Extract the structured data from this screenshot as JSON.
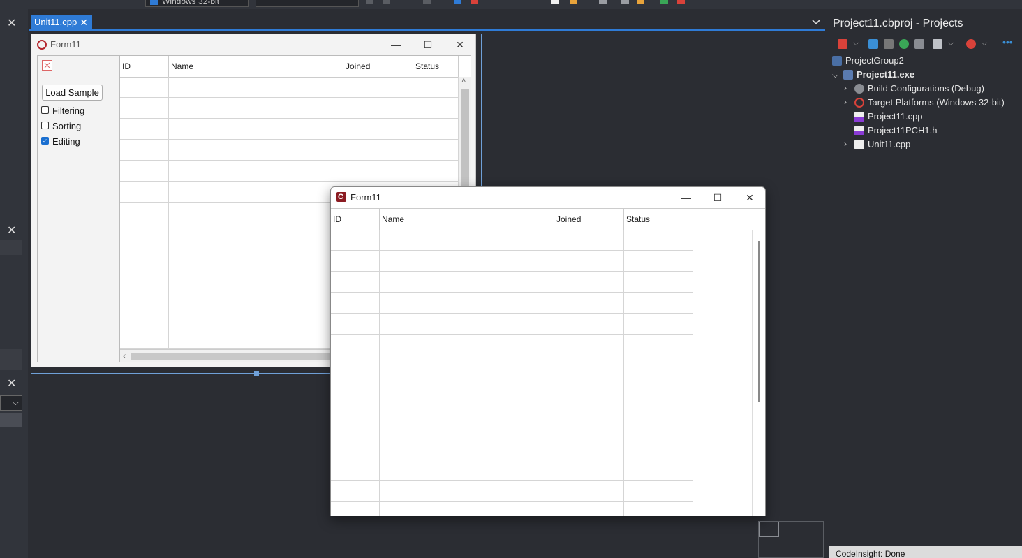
{
  "toolbar": {
    "platform": "Windows 32-bit",
    "config": ""
  },
  "editor": {
    "tab_label": "Unit11.cpp",
    "tab_close": "✕",
    "tab_dropdown_icon": "chevron-down-icon"
  },
  "design_form": {
    "title": "Form11",
    "minimize": "—",
    "maximize": "☐",
    "close": "✕",
    "load_button": "Load Sample",
    "checkboxes": [
      {
        "label": "Filtering",
        "checked": false
      },
      {
        "label": "Sorting",
        "checked": false
      },
      {
        "label": "Editing",
        "checked": true
      }
    ],
    "columns": [
      "ID",
      "Name",
      "Joined",
      "Status"
    ],
    "scroll_left": "‹",
    "scroll_up": "˄"
  },
  "run_form": {
    "title": "Form11",
    "minimize": "—",
    "maximize": "☐",
    "close": "✕",
    "columns": [
      "ID",
      "Name",
      "Joined",
      "Status"
    ]
  },
  "projects": {
    "title": "Project11.cbproj - Projects",
    "tree": [
      {
        "label": "ProjectGroup2",
        "icon": "project-group-icon"
      },
      {
        "label": "Project11.exe",
        "icon": "exe-icon",
        "bold": true
      },
      {
        "label": "Build Configurations (Debug)",
        "icon": "gears-icon"
      },
      {
        "label": "Target Platforms (Windows 32-bit)",
        "icon": "target-icon"
      },
      {
        "label": "Project11.cpp",
        "icon": "cpp-file-icon"
      },
      {
        "label": "Project11PCH1.h",
        "icon": "header-file-icon"
      },
      {
        "label": "Unit11.cpp",
        "icon": "unit-file-icon"
      }
    ],
    "status": "CodeInsight: Done"
  },
  "left_dock": {
    "close_1": "✕",
    "close_2": "✕",
    "close_3": "✕"
  },
  "colors": {
    "accent": "#2f7bd6",
    "ide_bg": "#2b2d33",
    "form_bg": "#f3f3f3"
  }
}
